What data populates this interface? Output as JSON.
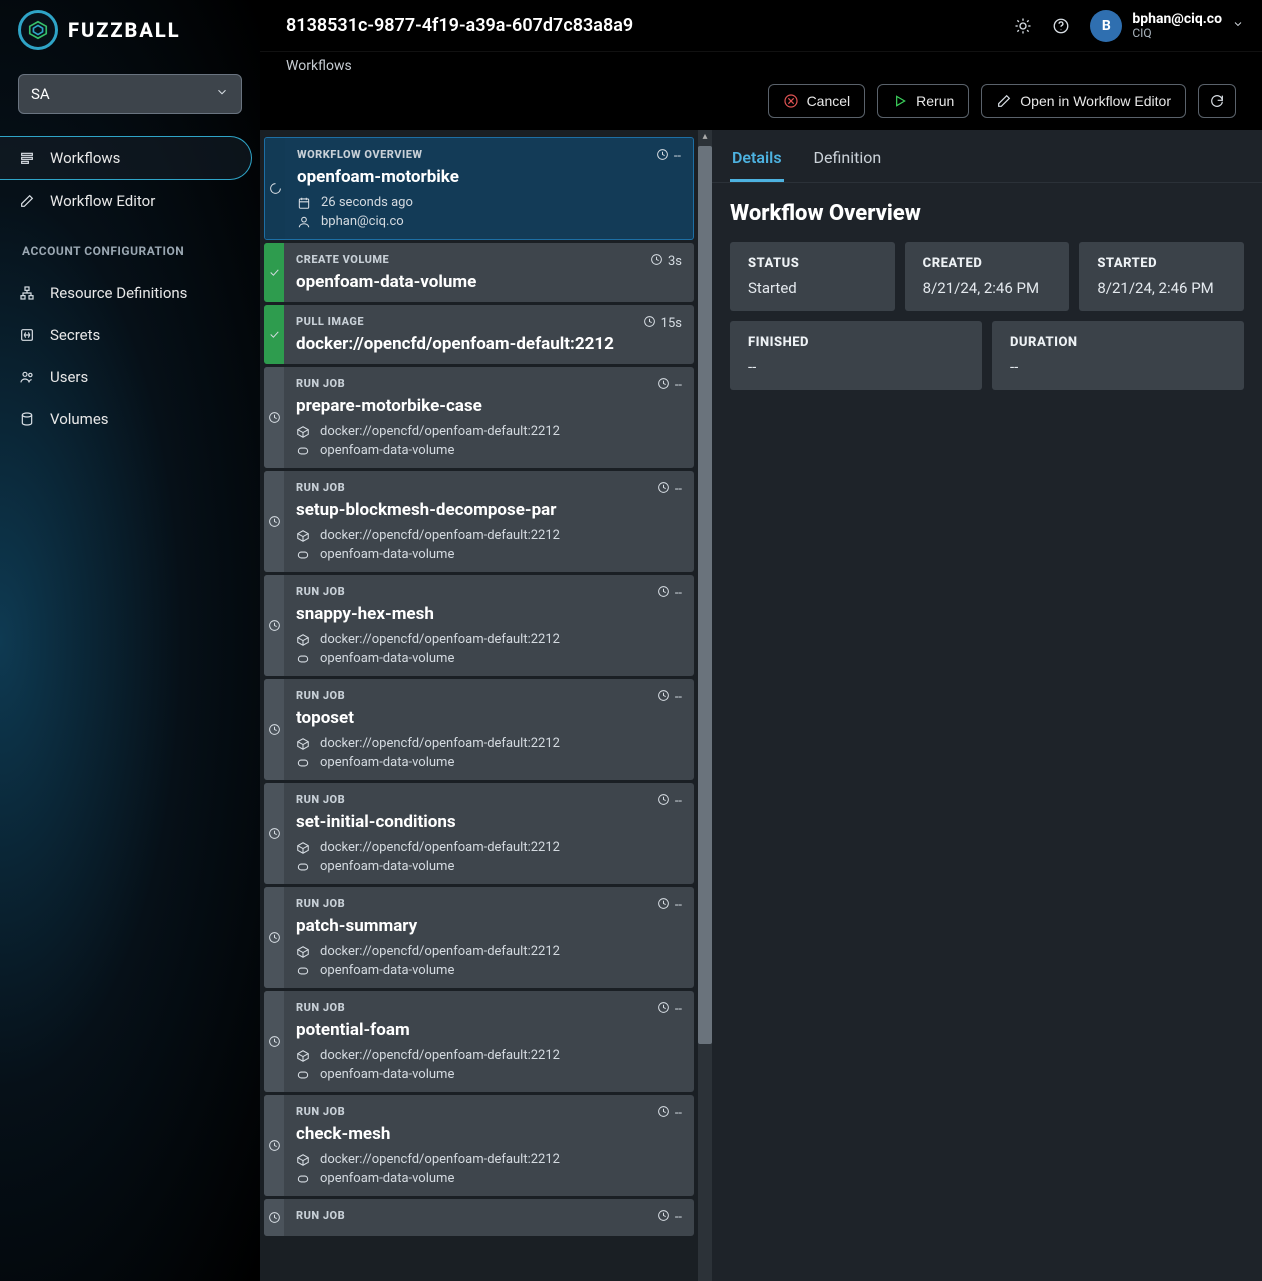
{
  "brand": {
    "name": "FUZZBALL"
  },
  "org_selector": {
    "value": "SA"
  },
  "sidebar": {
    "nav": [
      {
        "label": "Workflows",
        "icon": "workflows-icon",
        "active": true
      },
      {
        "label": "Workflow Editor",
        "icon": "edit-icon",
        "active": false
      }
    ],
    "section_label": "ACCOUNT CONFIGURATION",
    "account": [
      {
        "label": "Resource Definitions",
        "icon": "sitemap-icon"
      },
      {
        "label": "Secrets",
        "icon": "secret-icon"
      },
      {
        "label": "Users",
        "icon": "users-icon"
      },
      {
        "label": "Volumes",
        "icon": "volume-icon"
      }
    ]
  },
  "topbar": {
    "title": "8138531c-9877-4f19-a39a-607d7c83a8a9",
    "user": {
      "initial": "B",
      "email": "bphan@ciq.co",
      "org": "CIQ"
    }
  },
  "breadcrumbs": "Workflows",
  "actions": {
    "cancel": "Cancel",
    "rerun": "Rerun",
    "open_editor": "Open in Workflow Editor"
  },
  "steps": [
    {
      "status": "running",
      "selected": true,
      "kind": "WORKFLOW OVERVIEW",
      "title": "openfoam-motorbike",
      "duration": "--",
      "meta": [
        {
          "icon": "calendar-icon",
          "text": "26 seconds ago"
        },
        {
          "icon": "user-icon",
          "text": "bphan@ciq.co"
        }
      ]
    },
    {
      "status": "done",
      "kind": "CREATE VOLUME",
      "title": "openfoam-data-volume",
      "duration": "3s",
      "meta": []
    },
    {
      "status": "done",
      "kind": "PULL IMAGE",
      "title": "docker://opencfd/openfoam-default:2212",
      "duration": "15s",
      "meta": []
    },
    {
      "status": "pending",
      "kind": "RUN JOB",
      "title": "prepare-motorbike-case",
      "duration": "--",
      "meta": [
        {
          "icon": "cube-icon",
          "text": "docker://opencfd/openfoam-default:2212"
        },
        {
          "icon": "disk-icon",
          "text": "openfoam-data-volume"
        }
      ]
    },
    {
      "status": "pending",
      "kind": "RUN JOB",
      "title": "setup-blockmesh-decompose-par",
      "duration": "--",
      "meta": [
        {
          "icon": "cube-icon",
          "text": "docker://opencfd/openfoam-default:2212"
        },
        {
          "icon": "disk-icon",
          "text": "openfoam-data-volume"
        }
      ]
    },
    {
      "status": "pending",
      "kind": "RUN JOB",
      "title": "snappy-hex-mesh",
      "duration": "--",
      "meta": [
        {
          "icon": "cube-icon",
          "text": "docker://opencfd/openfoam-default:2212"
        },
        {
          "icon": "disk-icon",
          "text": "openfoam-data-volume"
        }
      ]
    },
    {
      "status": "pending",
      "kind": "RUN JOB",
      "title": "toposet",
      "duration": "--",
      "meta": [
        {
          "icon": "cube-icon",
          "text": "docker://opencfd/openfoam-default:2212"
        },
        {
          "icon": "disk-icon",
          "text": "openfoam-data-volume"
        }
      ]
    },
    {
      "status": "pending",
      "kind": "RUN JOB",
      "title": "set-initial-conditions",
      "duration": "--",
      "meta": [
        {
          "icon": "cube-icon",
          "text": "docker://opencfd/openfoam-default:2212"
        },
        {
          "icon": "disk-icon",
          "text": "openfoam-data-volume"
        }
      ]
    },
    {
      "status": "pending",
      "kind": "RUN JOB",
      "title": "patch-summary",
      "duration": "--",
      "meta": [
        {
          "icon": "cube-icon",
          "text": "docker://opencfd/openfoam-default:2212"
        },
        {
          "icon": "disk-icon",
          "text": "openfoam-data-volume"
        }
      ]
    },
    {
      "status": "pending",
      "kind": "RUN JOB",
      "title": "potential-foam",
      "duration": "--",
      "meta": [
        {
          "icon": "cube-icon",
          "text": "docker://opencfd/openfoam-default:2212"
        },
        {
          "icon": "disk-icon",
          "text": "openfoam-data-volume"
        }
      ]
    },
    {
      "status": "pending",
      "kind": "RUN JOB",
      "title": "check-mesh",
      "duration": "--",
      "meta": [
        {
          "icon": "cube-icon",
          "text": "docker://opencfd/openfoam-default:2212"
        },
        {
          "icon": "disk-icon",
          "text": "openfoam-data-volume"
        }
      ]
    },
    {
      "status": "pending",
      "kind": "RUN JOB",
      "title": "",
      "duration": "--",
      "meta": []
    }
  ],
  "tabs": {
    "details": "Details",
    "definition": "Definition"
  },
  "details": {
    "heading": "Workflow Overview",
    "cards_row1": [
      {
        "label": "STATUS",
        "value": "Started"
      },
      {
        "label": "CREATED",
        "value": "8/21/24, 2:46 PM"
      },
      {
        "label": "STARTED",
        "value": "8/21/24, 2:46 PM"
      }
    ],
    "cards_row2": [
      {
        "label": "FINISHED",
        "value": "--"
      },
      {
        "label": "DURATION",
        "value": "--"
      }
    ]
  }
}
